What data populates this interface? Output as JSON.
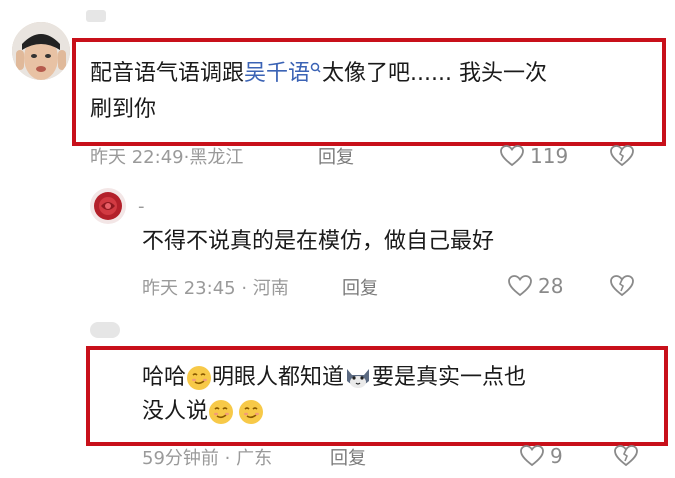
{
  "comments": [
    {
      "text_before": "配音语气语调跟",
      "mention": "吴千语",
      "text_after": "太像了吧...... 我头一次",
      "line2": "刷到你",
      "time": "昨天 22:49",
      "location": "黑龙江",
      "reply_label": "回复",
      "likes": "119",
      "highlighted": true
    },
    {
      "username": "-",
      "text": "不得不说真的是在模仿，做自己最好",
      "time": "昨天 23:45",
      "location": "河南",
      "reply_label": "回复",
      "likes": "28",
      "highlighted": false
    },
    {
      "text_a": "哈哈",
      "text_b": "明眼人都知道",
      "text_c": "要是真实一点也",
      "line2": "没人说",
      "time": "59分钟前",
      "location": "广东",
      "reply_label": "回复",
      "likes": "9",
      "highlighted": true
    }
  ],
  "colors": {
    "highlight_box": "#c8101a",
    "mention": "#3b63b5",
    "meta_text": "#9a9a9a"
  },
  "icons": [
    "heart-outline-icon",
    "broken-heart-icon",
    "smirk-emoji-icon",
    "cat-emoji-icon",
    "location-pin-icon"
  ]
}
